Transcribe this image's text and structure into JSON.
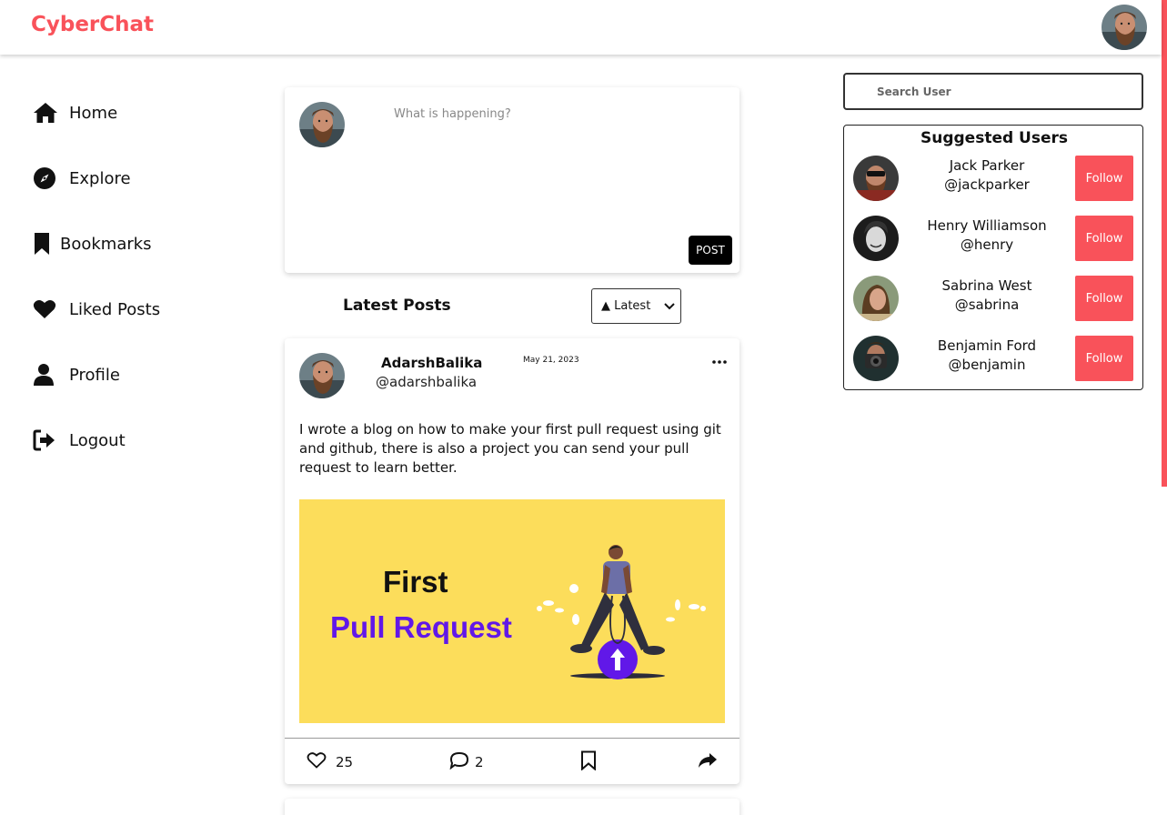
{
  "app": {
    "brand": "CyberChat",
    "accent": "#f9525a"
  },
  "sidebar": {
    "items": [
      {
        "label": "Home",
        "icon": "home-icon"
      },
      {
        "label": "Explore",
        "icon": "compass-icon"
      },
      {
        "label": "Bookmarks",
        "icon": "bookmark-icon"
      },
      {
        "label": "Liked Posts",
        "icon": "heart-icon"
      },
      {
        "label": "Profile",
        "icon": "user-icon"
      },
      {
        "label": "Logout",
        "icon": "logout-icon"
      }
    ]
  },
  "composer": {
    "placeholder": "What is happening?",
    "post_label": "POST"
  },
  "feed": {
    "title": "Latest Posts",
    "sort_selected": "▲ Latest"
  },
  "post": {
    "name": "AdarshBalika",
    "handle": "@adarshbalika",
    "date": "May 21, 2023",
    "body": "I wrote a blog on how to make your first pull request using git and github, there is also a project you can send your pull request to learn better.",
    "image": {
      "line1": "First",
      "line2": "Pull Request",
      "bg": "#fcdd5b",
      "accent": "#6118e8"
    },
    "likes": "25",
    "comments": "2"
  },
  "search": {
    "placeholder": "Search User"
  },
  "suggested": {
    "title": "Suggested Users",
    "follow_label": "Follow",
    "users": [
      {
        "name": "Jack Parker",
        "handle": "@jackparker"
      },
      {
        "name": "Henry Williamson",
        "handle": "@henry"
      },
      {
        "name": "Sabrina West",
        "handle": "@sabrina"
      },
      {
        "name": "Benjamin Ford",
        "handle": "@benjamin"
      }
    ]
  }
}
